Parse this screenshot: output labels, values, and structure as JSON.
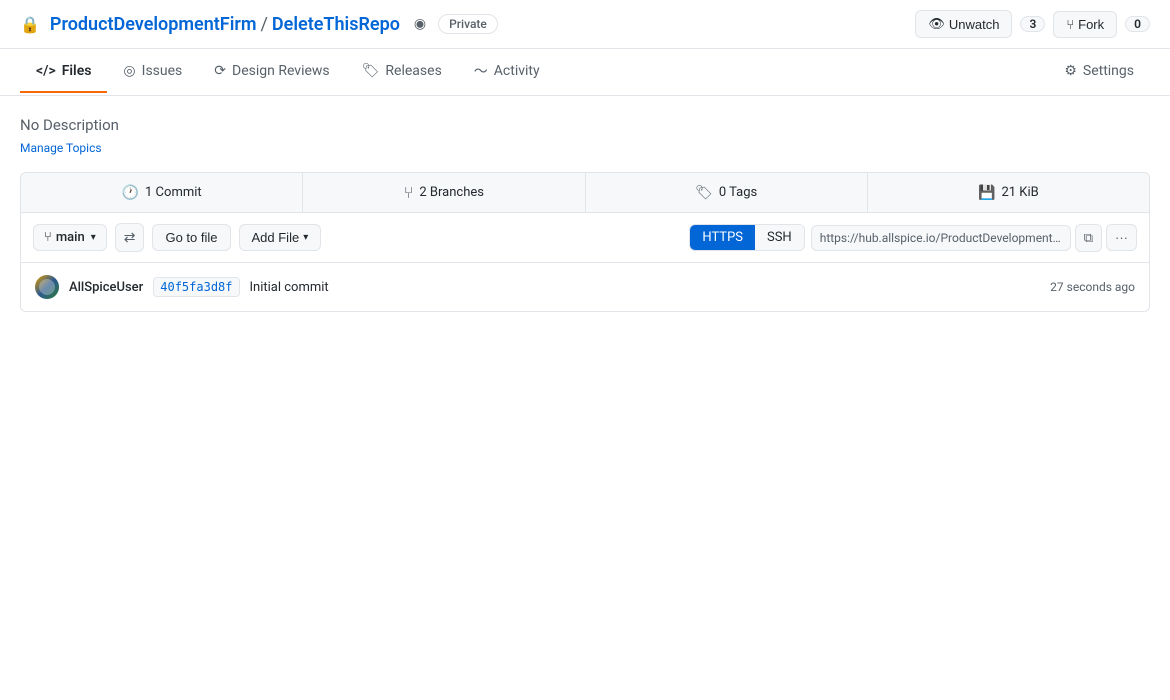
{
  "topbar": {
    "lock_icon": "🔒",
    "org_name": "ProductDevelopmentFirm",
    "repo_name": "DeleteThisRepo",
    "feed_icon": "◉",
    "private_label": "Private",
    "unwatch_label": "Unwatch",
    "watch_count": "3",
    "fork_label": "Fork",
    "fork_count": "0"
  },
  "nav": {
    "files_label": "Files",
    "issues_label": "Issues",
    "design_reviews_label": "Design Reviews",
    "releases_label": "Releases",
    "activity_label": "Activity",
    "settings_label": "Settings"
  },
  "repo": {
    "description": "No Description",
    "manage_topics": "Manage Topics"
  },
  "stats": {
    "commits_icon": "🕐",
    "commits_label": "1 Commit",
    "branches_icon": "⑂",
    "branches_label": "2 Branches",
    "tags_icon": "🏷",
    "tags_label": "0 Tags",
    "size_icon": "💾",
    "size_label": "21 KiB"
  },
  "toolbar": {
    "branch_name": "main",
    "goto_file_label": "Go to file",
    "add_file_label": "Add File",
    "https_label": "HTTPS",
    "ssh_label": "SSH",
    "clone_url": "https://hub.allspice.io/ProductDevelopmentFirm/Delet",
    "copy_icon": "⧉",
    "more_icon": "···"
  },
  "commit": {
    "username": "AllSpiceUser",
    "hash": "40f5fa3d8f",
    "message": "Initial commit",
    "time": "27 seconds ago"
  }
}
